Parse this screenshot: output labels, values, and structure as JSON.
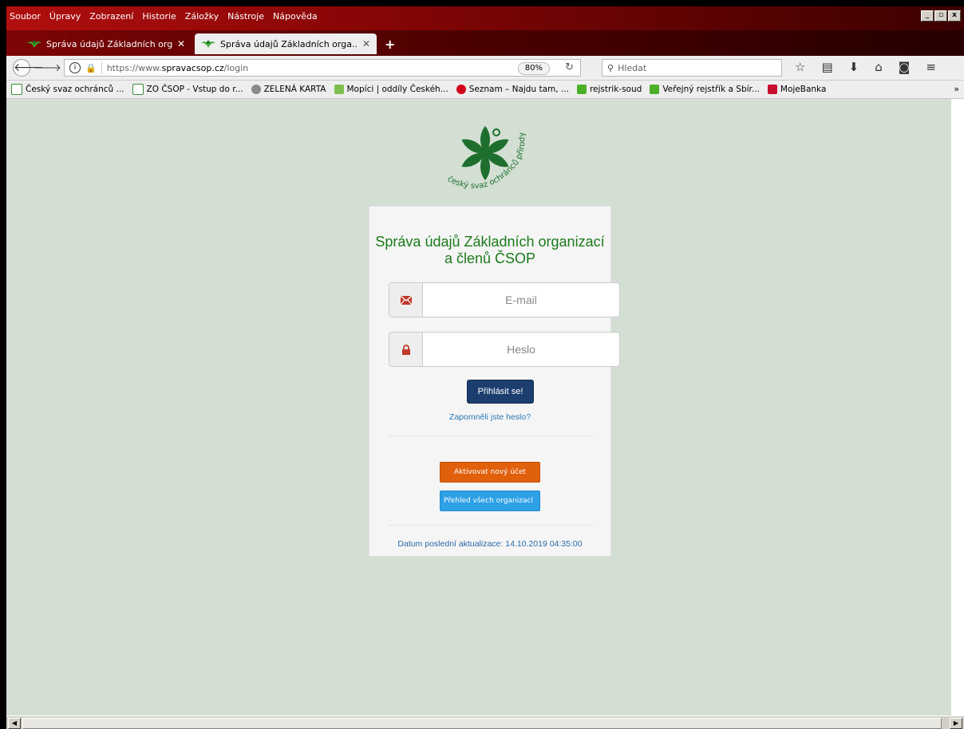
{
  "menu": [
    "Soubor",
    "Úpravy",
    "Zobrazení",
    "Historie",
    "Záložky",
    "Nástroje",
    "Nápověda"
  ],
  "tabs": [
    {
      "title": "Správa údajů Základních orga...",
      "close": "✕"
    },
    {
      "title": "Správa údajů Základních orga...",
      "close": "✕"
    }
  ],
  "newtab": "+",
  "nav": {
    "url_prefix": "https://www.",
    "url_host": "spravacsop.cz",
    "url_path": "/login",
    "zoom": "80%",
    "search_placeholder": "Hledat"
  },
  "bookmarks": [
    {
      "label": "Český svaz ochránců ...",
      "icon": "csop-leaf-icon"
    },
    {
      "label": "ZO ČSOP - Vstup do r...",
      "icon": "csop-leaf-icon"
    },
    {
      "label": "ZELENÁ KARTA",
      "icon": "globe-icon"
    },
    {
      "label": "Mopíci | oddíly Českéh...",
      "icon": "bird-icon"
    },
    {
      "label": "Seznam – Najdu tam, ...",
      "icon": "seznam-icon"
    },
    {
      "label": "rejstrik-soud",
      "icon": "justice-icon"
    },
    {
      "label": "Veřejný rejstřík a Sbír...",
      "icon": "justice-icon"
    },
    {
      "label": "MojeBanka",
      "icon": "bank-icon"
    }
  ],
  "logo_text": "český svaz ochránců přírody",
  "login": {
    "title": "Správa údajů Základních organizací a členů ČSOP",
    "email_placeholder": "E-mail",
    "password_placeholder": "Heslo",
    "submit": "Přihlásit se!",
    "forgot": "Zapomněli jste heslo?",
    "activate": "Aktivovat nový účet",
    "overview": "Přehled všech organizací",
    "updated": "Datum poslední aktualizace: 14.10.2019 04:35:00"
  },
  "colors": {
    "brand_green": "#1a7a1a",
    "login_button": "#1b3e6e",
    "activate_button": "#e0600c",
    "overview_button": "#2da0e6",
    "page_bg": "#d3dfd3"
  }
}
